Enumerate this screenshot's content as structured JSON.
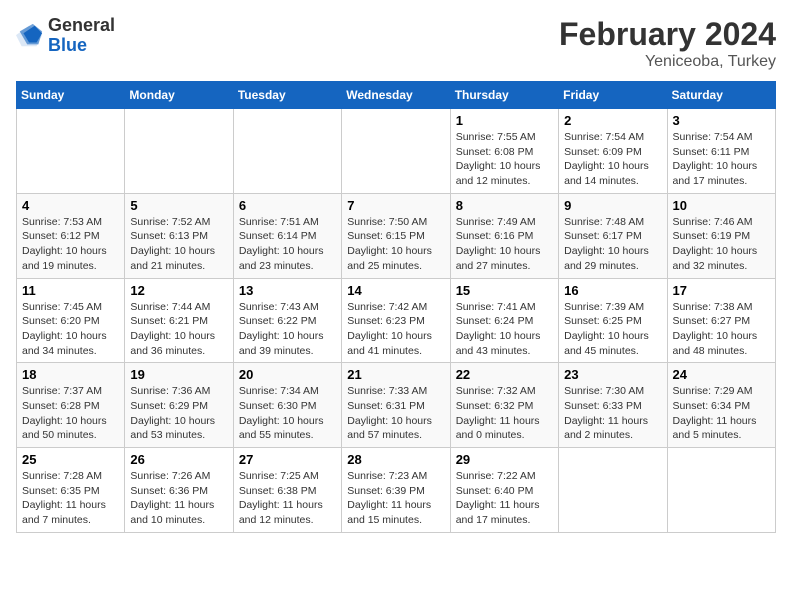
{
  "header": {
    "logo_general": "General",
    "logo_blue": "Blue",
    "month_title": "February 2024",
    "location": "Yeniceoba, Turkey"
  },
  "days_of_week": [
    "Sunday",
    "Monday",
    "Tuesday",
    "Wednesday",
    "Thursday",
    "Friday",
    "Saturday"
  ],
  "weeks": [
    [
      {
        "day": "",
        "info": ""
      },
      {
        "day": "",
        "info": ""
      },
      {
        "day": "",
        "info": ""
      },
      {
        "day": "",
        "info": ""
      },
      {
        "day": "1",
        "info": "Sunrise: 7:55 AM\nSunset: 6:08 PM\nDaylight: 10 hours\nand 12 minutes."
      },
      {
        "day": "2",
        "info": "Sunrise: 7:54 AM\nSunset: 6:09 PM\nDaylight: 10 hours\nand 14 minutes."
      },
      {
        "day": "3",
        "info": "Sunrise: 7:54 AM\nSunset: 6:11 PM\nDaylight: 10 hours\nand 17 minutes."
      }
    ],
    [
      {
        "day": "4",
        "info": "Sunrise: 7:53 AM\nSunset: 6:12 PM\nDaylight: 10 hours\nand 19 minutes."
      },
      {
        "day": "5",
        "info": "Sunrise: 7:52 AM\nSunset: 6:13 PM\nDaylight: 10 hours\nand 21 minutes."
      },
      {
        "day": "6",
        "info": "Sunrise: 7:51 AM\nSunset: 6:14 PM\nDaylight: 10 hours\nand 23 minutes."
      },
      {
        "day": "7",
        "info": "Sunrise: 7:50 AM\nSunset: 6:15 PM\nDaylight: 10 hours\nand 25 minutes."
      },
      {
        "day": "8",
        "info": "Sunrise: 7:49 AM\nSunset: 6:16 PM\nDaylight: 10 hours\nand 27 minutes."
      },
      {
        "day": "9",
        "info": "Sunrise: 7:48 AM\nSunset: 6:17 PM\nDaylight: 10 hours\nand 29 minutes."
      },
      {
        "day": "10",
        "info": "Sunrise: 7:46 AM\nSunset: 6:19 PM\nDaylight: 10 hours\nand 32 minutes."
      }
    ],
    [
      {
        "day": "11",
        "info": "Sunrise: 7:45 AM\nSunset: 6:20 PM\nDaylight: 10 hours\nand 34 minutes."
      },
      {
        "day": "12",
        "info": "Sunrise: 7:44 AM\nSunset: 6:21 PM\nDaylight: 10 hours\nand 36 minutes."
      },
      {
        "day": "13",
        "info": "Sunrise: 7:43 AM\nSunset: 6:22 PM\nDaylight: 10 hours\nand 39 minutes."
      },
      {
        "day": "14",
        "info": "Sunrise: 7:42 AM\nSunset: 6:23 PM\nDaylight: 10 hours\nand 41 minutes."
      },
      {
        "day": "15",
        "info": "Sunrise: 7:41 AM\nSunset: 6:24 PM\nDaylight: 10 hours\nand 43 minutes."
      },
      {
        "day": "16",
        "info": "Sunrise: 7:39 AM\nSunset: 6:25 PM\nDaylight: 10 hours\nand 45 minutes."
      },
      {
        "day": "17",
        "info": "Sunrise: 7:38 AM\nSunset: 6:27 PM\nDaylight: 10 hours\nand 48 minutes."
      }
    ],
    [
      {
        "day": "18",
        "info": "Sunrise: 7:37 AM\nSunset: 6:28 PM\nDaylight: 10 hours\nand 50 minutes."
      },
      {
        "day": "19",
        "info": "Sunrise: 7:36 AM\nSunset: 6:29 PM\nDaylight: 10 hours\nand 53 minutes."
      },
      {
        "day": "20",
        "info": "Sunrise: 7:34 AM\nSunset: 6:30 PM\nDaylight: 10 hours\nand 55 minutes."
      },
      {
        "day": "21",
        "info": "Sunrise: 7:33 AM\nSunset: 6:31 PM\nDaylight: 10 hours\nand 57 minutes."
      },
      {
        "day": "22",
        "info": "Sunrise: 7:32 AM\nSunset: 6:32 PM\nDaylight: 11 hours\nand 0 minutes."
      },
      {
        "day": "23",
        "info": "Sunrise: 7:30 AM\nSunset: 6:33 PM\nDaylight: 11 hours\nand 2 minutes."
      },
      {
        "day": "24",
        "info": "Sunrise: 7:29 AM\nSunset: 6:34 PM\nDaylight: 11 hours\nand 5 minutes."
      }
    ],
    [
      {
        "day": "25",
        "info": "Sunrise: 7:28 AM\nSunset: 6:35 PM\nDaylight: 11 hours\nand 7 minutes."
      },
      {
        "day": "26",
        "info": "Sunrise: 7:26 AM\nSunset: 6:36 PM\nDaylight: 11 hours\nand 10 minutes."
      },
      {
        "day": "27",
        "info": "Sunrise: 7:25 AM\nSunset: 6:38 PM\nDaylight: 11 hours\nand 12 minutes."
      },
      {
        "day": "28",
        "info": "Sunrise: 7:23 AM\nSunset: 6:39 PM\nDaylight: 11 hours\nand 15 minutes."
      },
      {
        "day": "29",
        "info": "Sunrise: 7:22 AM\nSunset: 6:40 PM\nDaylight: 11 hours\nand 17 minutes."
      },
      {
        "day": "",
        "info": ""
      },
      {
        "day": "",
        "info": ""
      }
    ]
  ]
}
